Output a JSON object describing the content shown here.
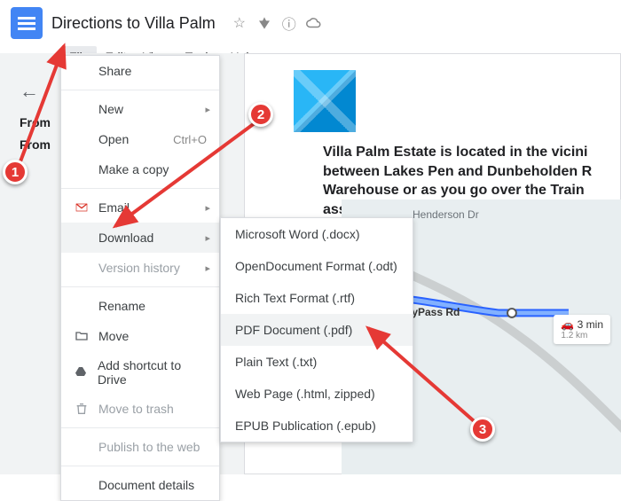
{
  "titlebar": {
    "doc_title": "Directions to Villa Palm"
  },
  "menubar": {
    "items": [
      "File",
      "Edit",
      "View",
      "Tools",
      "Help"
    ]
  },
  "sidebar": {
    "line1": "From",
    "line2": "From"
  },
  "file_menu": {
    "share": "Share",
    "new": "New",
    "open": "Open",
    "open_shortcut": "Ctrl+O",
    "make_copy": "Make a copy",
    "email": "Email",
    "download": "Download",
    "version_history": "Version history",
    "rename": "Rename",
    "move": "Move",
    "add_shortcut": "Add shortcut to Drive",
    "move_trash": "Move to trash",
    "publish": "Publish to the web",
    "details": "Document details"
  },
  "download_submenu": {
    "items": [
      "Microsoft Word (.docx)",
      "OpenDocument Format (.odt)",
      "Rich Text Format (.rtf)",
      "PDF Document (.pdf)",
      "Plain Text (.txt)",
      "Web Page (.html, zipped)",
      "EPUB Publication (.epub)"
    ]
  },
  "doc_body": {
    "paragraph": "Villa Palm Estate is located in the vicini between Lakes Pen and Dunbeholden R Warehouse or as you go over the Train assembly Church from Lakes Pen"
  },
  "map": {
    "road1": "Henderson Dr",
    "road2": "n ByPass Rd",
    "time": "3 min",
    "dist": "1.2 km"
  },
  "annotations": {
    "marker1": "1",
    "marker2": "2",
    "marker3": "3"
  }
}
